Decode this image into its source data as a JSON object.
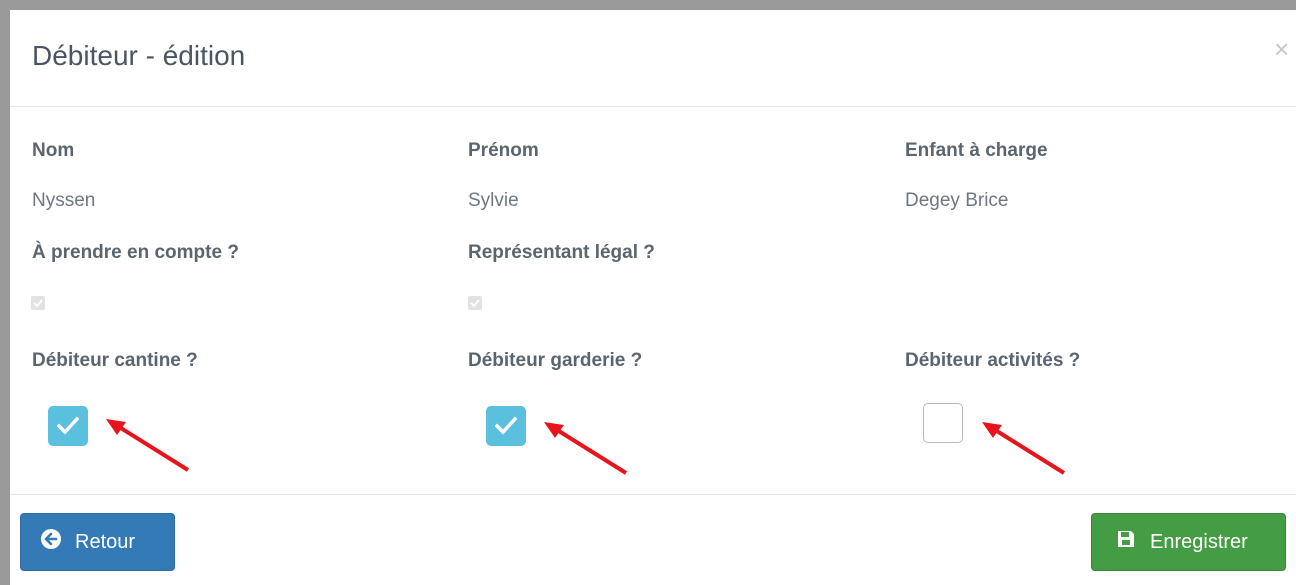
{
  "modal": {
    "title": "Débiteur - édition",
    "close_symbol": "×"
  },
  "fields": {
    "nom": {
      "label": "Nom",
      "value": "Nyssen"
    },
    "prenom": {
      "label": "Prénom",
      "value": "Sylvie"
    },
    "enfant": {
      "label": "Enfant à charge",
      "value": "Degey Brice"
    },
    "a_prendre": {
      "label": "À prendre en compte ?",
      "checked": true,
      "disabled": true
    },
    "representant": {
      "label": "Représentant légal ?",
      "checked": true,
      "disabled": true
    },
    "cantine": {
      "label": "Débiteur cantine ?",
      "checked": true
    },
    "garderie": {
      "label": "Débiteur garderie ?",
      "checked": true
    },
    "activites": {
      "label": "Débiteur activités ?",
      "checked": false
    }
  },
  "buttons": {
    "back": {
      "label": "Retour",
      "icon": "arrow-circle-left-icon",
      "color": "#337ab7"
    },
    "save": {
      "label": "Enregistrer",
      "icon": "floppy-disk-icon",
      "color": "#449d44"
    }
  },
  "colors": {
    "checkbox_active": "#5bc0de",
    "annotation_arrow": "#e8141b"
  }
}
